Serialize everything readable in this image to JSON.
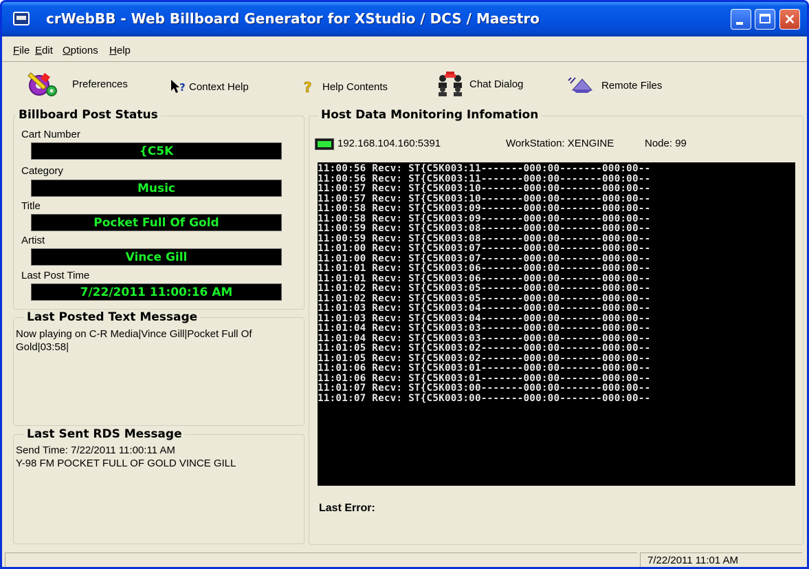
{
  "window": {
    "title": "crWebBB - Web Billboard Generator for XStudio / DCS / Maestro"
  },
  "menu": [
    {
      "label_u": "F",
      "label_rest": "ile"
    },
    {
      "label_u": "E",
      "label_rest": "dit"
    },
    {
      "label_u": "O",
      "label_rest": "ptions"
    },
    {
      "label_u": "H",
      "label_rest": "elp"
    }
  ],
  "toolbar": {
    "preferences": "Preferences",
    "context_help": "Context Help",
    "help_contents": "Help Contents",
    "chat_dialog": "Chat Dialog",
    "remote_files": "Remote Files"
  },
  "billboard": {
    "title": "Billboard Post Status",
    "cart_label": "Cart Number",
    "cart_value": "{C5K",
    "category_label": "Category",
    "category_value": "Music",
    "title_label": "Title",
    "title_value": "Pocket Full Of Gold",
    "artist_label": "Artist",
    "artist_value": "Vince Gill",
    "lastpost_label": "Last Post Time",
    "lastpost_value": "7/22/2011 11:00:16 AM"
  },
  "last_posted": {
    "title": "Last Posted Text Message",
    "line1": "Now playing on C-R Media|Vince Gill|Pocket Full Of",
    "line2": "Gold|03:58|"
  },
  "last_rds": {
    "title": "Last Sent RDS Message",
    "line1": "Send Time: 7/22/2011 11:00:11 AM",
    "line2": "Y-98 FM POCKET FULL OF GOLD VINCE GILL"
  },
  "host": {
    "title": "Host Data Monitoring Infomation",
    "address": "192.168.104.160:5391",
    "workstation": "WorkStation: XENGINE",
    "node": "Node: 99",
    "last_error_label": "Last Error:",
    "log": [
      "11:00:56 Recv: ST{C5K003:11-------000:00-------000:00--",
      "11:00:56 Recv: ST{C5K003:11-------000:00-------000:00--",
      "11:00:57 Recv: ST{C5K003:10-------000:00-------000:00--",
      "11:00:57 Recv: ST{C5K003:10-------000:00-------000:00--",
      "11:00:58 Recv: ST{C5K003:09-------000:00-------000:00--",
      "11:00:58 Recv: ST{C5K003:09-------000:00-------000:00--",
      "11:00:59 Recv: ST{C5K003:08-------000:00-------000:00--",
      "11:00:59 Recv: ST{C5K003:08-------000:00-------000:00--",
      "11:01:00 Recv: ST{C5K003:07-------000:00-------000:00--",
      "11:01:00 Recv: ST{C5K003:07-------000:00-------000:00--",
      "11:01:01 Recv: ST{C5K003:06-------000:00-------000:00--",
      "11:01:01 Recv: ST{C5K003:06-------000:00-------000:00--",
      "11:01:02 Recv: ST{C5K003:05-------000:00-------000:00--",
      "11:01:02 Recv: ST{C5K003:05-------000:00-------000:00--",
      "11:01:03 Recv: ST{C5K003:04-------000:00-------000:00--",
      "11:01:03 Recv: ST{C5K003:04-------000:00-------000:00--",
      "11:01:04 Recv: ST{C5K003:03-------000:00-------000:00--",
      "11:01:04 Recv: ST{C5K003:03-------000:00-------000:00--",
      "11:01:05 Recv: ST{C5K003:02-------000:00-------000:00--",
      "11:01:05 Recv: ST{C5K003:02-------000:00-------000:00--",
      "11:01:06 Recv: ST{C5K003:01-------000:00-------000:00--",
      "11:01:06 Recv: ST{C5K003:01-------000:00-------000:00--",
      "11:01:07 Recv: ST{C5K003:00-------000:00-------000:00--",
      "11:01:07 Recv: ST{C5K003:00-------000:00-------000:00--"
    ]
  },
  "status": {
    "datetime": "7/22/2011 11:01 AM"
  },
  "colors": {
    "led_text": "#19f02a",
    "console_bg": "#000000",
    "console_text": "#e8e8e8",
    "window_face": "#ece9d8",
    "titlebar": "#0554e3"
  },
  "icons": {
    "preferences": "gears-icon",
    "context_help": "pointer-help-icon",
    "help_contents": "question-icon",
    "chat_dialog": "chat-people-icon",
    "remote_files": "remote-files-icon",
    "connection": "connection-led-icon"
  }
}
